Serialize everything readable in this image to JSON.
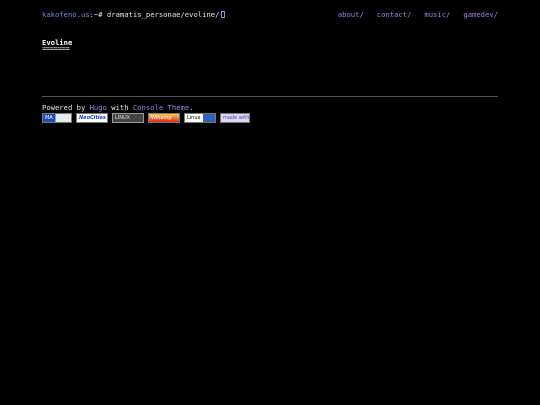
{
  "header": {
    "host": "kakofeno.us",
    "prompt_sep": ":~# ",
    "path": "dramatis_personae/evoline/",
    "nav": [
      {
        "label": "about/"
      },
      {
        "label": "contact/"
      },
      {
        "label": "music/"
      },
      {
        "label": "gamedev/"
      }
    ]
  },
  "main": {
    "title": "Evoline",
    "underline": "======="
  },
  "footer": {
    "powered_prefix": "Powered by ",
    "hugo": "Hugo",
    "with_text": " with ",
    "theme": "Console Theme",
    "period": ".",
    "badges": [
      {
        "label": "MA"
      },
      {
        "label": "NeoCities"
      },
      {
        "label": "LINUX"
      },
      {
        "label": "Winamp"
      },
      {
        "label": "Linux"
      },
      {
        "label": "made with"
      }
    ]
  },
  "colors": {
    "background": "#000000",
    "text": "#e6e6e6",
    "accent_purple": "#a47ee8",
    "host_blue": "#6d8de0"
  }
}
